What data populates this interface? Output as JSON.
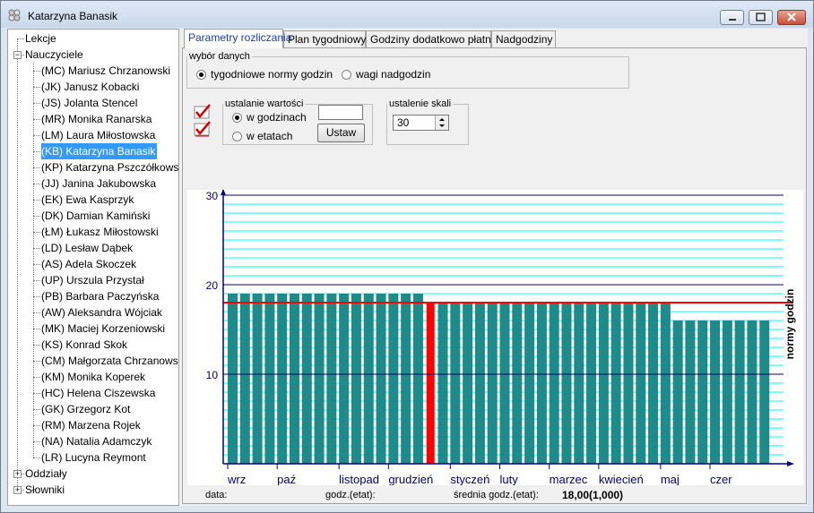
{
  "window": {
    "title": "Katarzyna Banasik"
  },
  "tree": {
    "items": [
      {
        "label": "Lekcje",
        "level": 0,
        "expander": ""
      },
      {
        "label": "Nauczyciele",
        "level": 0,
        "expander": "−"
      },
      {
        "label": "(MC) Mariusz Chrzanowski",
        "level": 1
      },
      {
        "label": "(JK) Janusz Kobacki",
        "level": 1
      },
      {
        "label": "(JS) Jolanta Stencel",
        "level": 1
      },
      {
        "label": "(MR) Monika Ranarska",
        "level": 1
      },
      {
        "label": "(LM) Laura Miłostowska",
        "level": 1
      },
      {
        "label": "(KB) Katarzyna Banasik",
        "level": 1,
        "selected": true
      },
      {
        "label": "(KP) Katarzyna Pszczółkowska",
        "level": 1
      },
      {
        "label": "(JJ) Janina Jakubowska",
        "level": 1
      },
      {
        "label": "(EK) Ewa Kasprzyk",
        "level": 1
      },
      {
        "label": "(DK) Damian Kamiński",
        "level": 1
      },
      {
        "label": "(ŁM) Łukasz Miłostowski",
        "level": 1
      },
      {
        "label": "(LD) Lesław Dąbek",
        "level": 1
      },
      {
        "label": "(AS) Adela Skoczek",
        "level": 1
      },
      {
        "label": "(UP) Urszula Przystał",
        "level": 1
      },
      {
        "label": "(PB) Barbara Paczyńska",
        "level": 1
      },
      {
        "label": "(AW) Aleksandra Wójciak",
        "level": 1
      },
      {
        "label": "(MK) Maciej Korzeniowski",
        "level": 1
      },
      {
        "label": "(KS) Konrad Skok",
        "level": 1
      },
      {
        "label": "(CM) Małgorzata Chrzanowska",
        "level": 1
      },
      {
        "label": "(KM) Monika Koperek",
        "level": 1
      },
      {
        "label": "(HC) Helena Ciszewska",
        "level": 1
      },
      {
        "label": "(GK) Grzegorz Kot",
        "level": 1
      },
      {
        "label": "(RM) Marzena Rojek",
        "level": 1
      },
      {
        "label": "(NA) Natalia Adamczyk",
        "level": 1
      },
      {
        "label": "(LR) Lucyna Reymont",
        "level": 1
      },
      {
        "label": "Oddziały",
        "level": 0,
        "expander": "+"
      },
      {
        "label": "Słowniki",
        "level": 0,
        "expander": "+"
      }
    ]
  },
  "tabs": [
    "Parametry rozliczania",
    "Plan tygodniowy",
    "Godziny dodatkowo płatne",
    "Nadgodziny"
  ],
  "wybor": {
    "legend": "wybór danych",
    "option1": "tygodniowe normy godzin",
    "option2": "wagi nadgodzin"
  },
  "ustalanie": {
    "legend": "ustalanie wartości",
    "opt_godziny": "w godzinach",
    "opt_etaty": "w etatach",
    "input_value": "",
    "button": "Ustaw"
  },
  "skala": {
    "legend": "ustalenie skali",
    "value": "30"
  },
  "status": {
    "data_label": "data:",
    "godz_label": "godz.(etat):",
    "srednia_label": "średnia godz.(etat):",
    "srednia_value": "18,00(1,000)"
  },
  "colors": {
    "bar": "#1f8a8a",
    "selected_bar": "#ff0000",
    "norm_line": "#ff0000",
    "major_grid": "#000080",
    "minor_grid": "#00ffff",
    "axis": "#000080"
  },
  "chart_data": {
    "type": "bar",
    "ylabel": "normy godzin",
    "ylim": [
      0,
      30
    ],
    "yticks": [
      "30",
      "20",
      "10"
    ],
    "month_labels": [
      "wrz",
      "paź",
      "listopad",
      "grudzień",
      "styczeń",
      "luty",
      "marzec",
      "kwiecień",
      "maj",
      "czer"
    ],
    "norm_line": 18,
    "highlight_index": 16,
    "values": [
      19,
      19,
      19,
      19,
      19,
      19,
      19,
      19,
      19,
      19,
      19,
      19,
      19,
      19,
      19,
      19,
      18,
      18,
      18,
      18,
      18,
      18,
      18,
      18,
      18,
      18,
      18,
      18,
      18,
      18,
      18,
      18,
      18,
      18,
      18,
      18,
      16,
      16,
      16,
      16,
      16,
      16,
      16,
      16
    ]
  }
}
